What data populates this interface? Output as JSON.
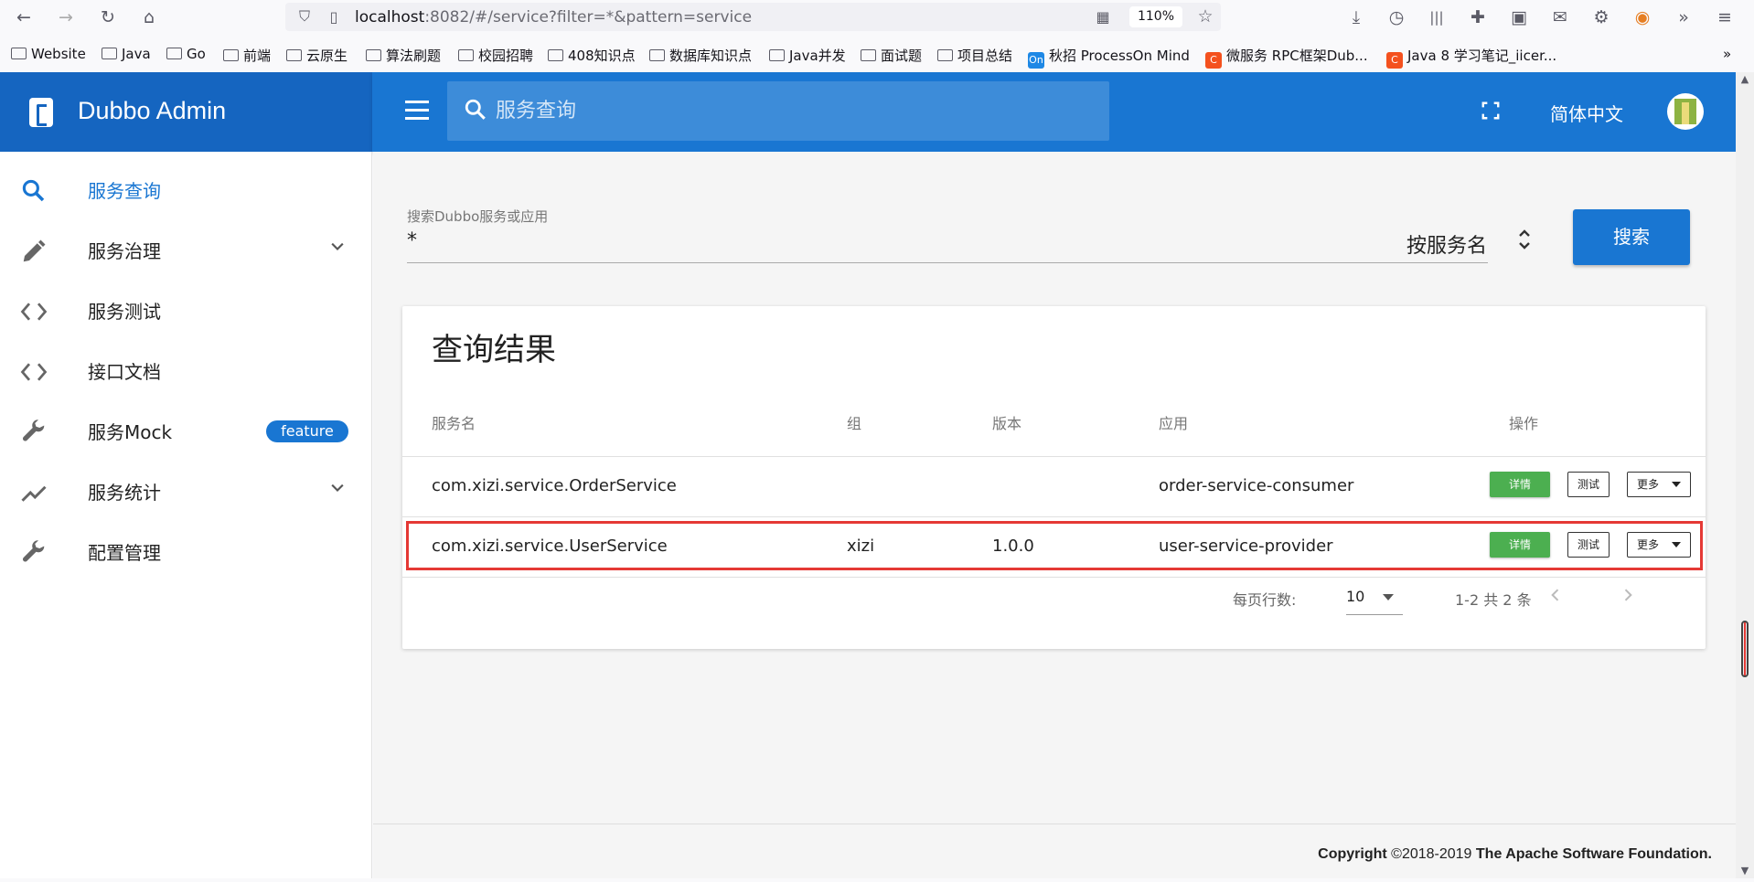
{
  "browser": {
    "url_host": "localhost",
    "url_path": ":8082/#/service?filter=*&pattern=service",
    "zoom": "110%",
    "bookmarks": [
      {
        "label": "Website",
        "type": "folder"
      },
      {
        "label": "Java",
        "type": "folder"
      },
      {
        "label": "Go",
        "type": "folder"
      },
      {
        "label": "前端",
        "type": "folder"
      },
      {
        "label": "云原生",
        "type": "folder"
      },
      {
        "label": "算法刷题",
        "type": "folder"
      },
      {
        "label": "校园招聘",
        "type": "folder"
      },
      {
        "label": "408知识点",
        "type": "folder"
      },
      {
        "label": "数据库知识点",
        "type": "folder"
      },
      {
        "label": "Java并发",
        "type": "folder"
      },
      {
        "label": "面试题",
        "type": "folder"
      },
      {
        "label": "项目总结",
        "type": "folder"
      },
      {
        "label": "秋招 ProcessOn Mind",
        "type": "on"
      },
      {
        "label": "微服务 RPC框架Dub...",
        "type": "c"
      },
      {
        "label": "Java 8 学习笔记_iicer...",
        "type": "c"
      }
    ]
  },
  "app": {
    "title": "Dubbo Admin",
    "search_placeholder": "服务查询",
    "language": "简体中文"
  },
  "sidebar": {
    "items": [
      {
        "label": "服务查询",
        "icon": "search-icon",
        "active": true
      },
      {
        "label": "服务治理",
        "icon": "pencil-icon",
        "expandable": true
      },
      {
        "label": "服务测试",
        "icon": "code-icon"
      },
      {
        "label": "接口文档",
        "icon": "code-icon"
      },
      {
        "label": "服务Mock",
        "icon": "wrench-icon",
        "badge": "feature"
      },
      {
        "label": "服务统计",
        "icon": "trending-icon",
        "expandable": true
      },
      {
        "label": "配置管理",
        "icon": "wrench-icon"
      }
    ]
  },
  "search": {
    "label": "搜索Dubbo服务或应用",
    "value": "*",
    "by": "按服务名",
    "button": "搜索"
  },
  "results": {
    "title": "查询结果",
    "headers": {
      "service": "服务名",
      "group": "组",
      "version": "版本",
      "app": "应用",
      "actions": "操作"
    },
    "rows": [
      {
        "service": "com.xizi.service.OrderService",
        "group": "",
        "version": "",
        "app": "order-service-consumer"
      },
      {
        "service": "com.xizi.service.UserService",
        "group": "xizi",
        "version": "1.0.0",
        "app": "user-service-provider"
      }
    ],
    "action_labels": {
      "detail": "详情",
      "test": "测试",
      "more": "更多"
    },
    "rows_per_page_label": "每页行数:",
    "rows_per_page": "10",
    "range": "1-2 共 2 条"
  },
  "footer": {
    "copyright_prefix": "Copyright",
    "copyright_years": " ©2018-2019 ",
    "org": "The Apache Software Foundation."
  },
  "colors": {
    "primary": "#1976d2",
    "primary_dark": "#1565c0",
    "success": "#4caf50",
    "highlight": "#e53935"
  }
}
